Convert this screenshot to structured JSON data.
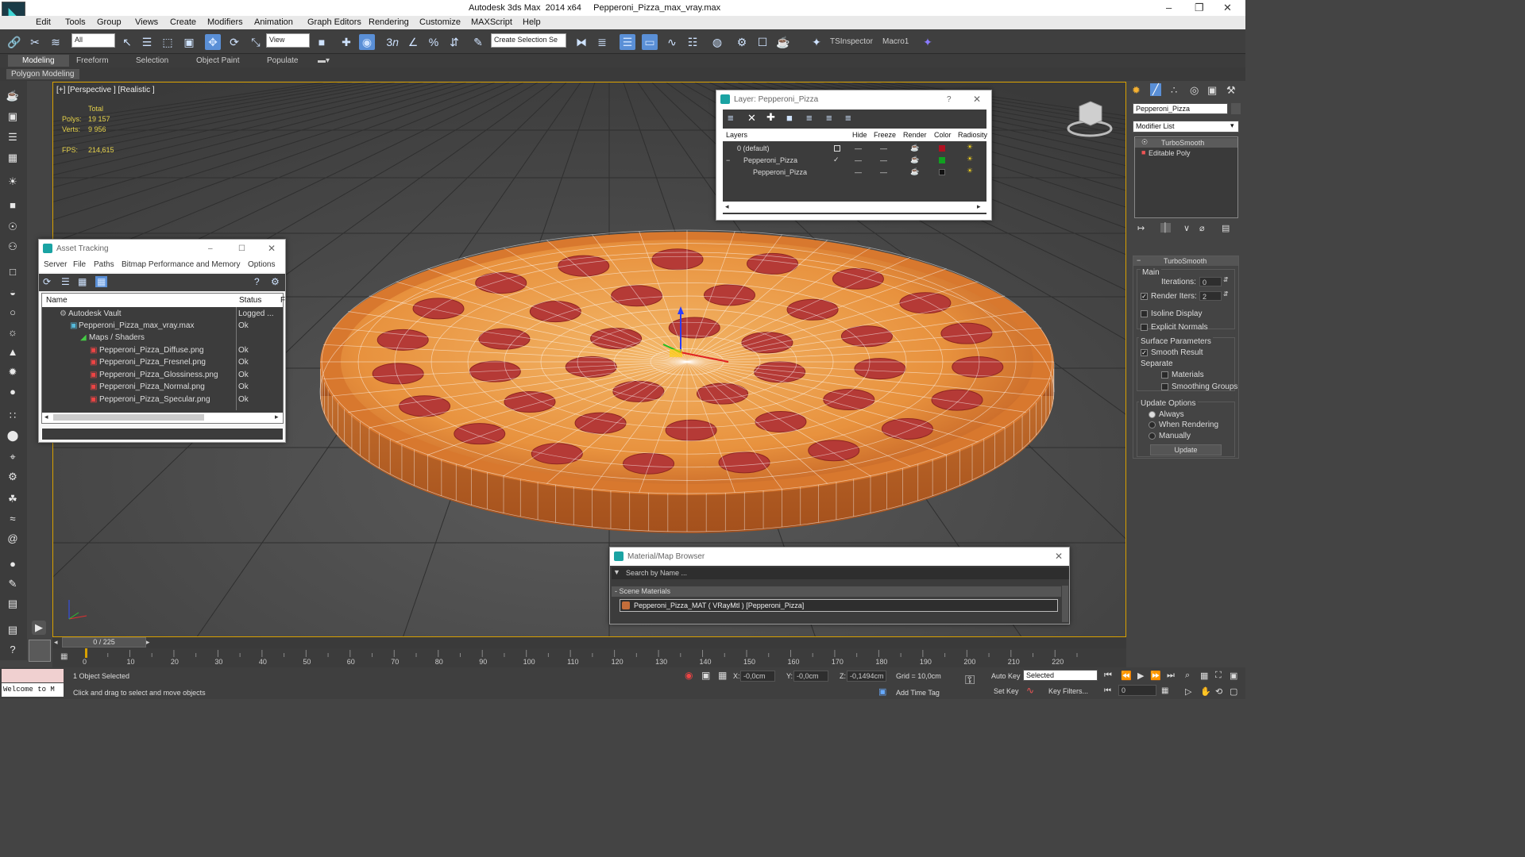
{
  "window": {
    "title": "Autodesk 3ds Max  2014 x64     Pepperoni_Pizza_max_vray.max"
  },
  "menu": [
    "Edit",
    "Tools",
    "Group",
    "Views",
    "Create",
    "Modifiers",
    "Animation",
    "Graph Editors",
    "Rendering",
    "Customize",
    "MAXScript",
    "Help"
  ],
  "toolbar": {
    "filter": "All",
    "ref_coord": "View",
    "selection_set": "Create Selection Se",
    "ts_inspector": "TSInspector",
    "macro": "Macro1"
  },
  "ribbon": {
    "tabs": [
      "Modeling",
      "Freeform",
      "Selection",
      "Object Paint",
      "Populate"
    ],
    "active": "Modeling",
    "sub": "Polygon Modeling"
  },
  "viewport": {
    "label": "[+] [Perspective ] [Realistic ]",
    "stats": {
      "total_label": "Total",
      "polys_label": "Polys:",
      "polys": "19 157",
      "verts_label": "Verts:",
      "verts": "9 956",
      "fps_label": "FPS:",
      "fps": "214,615"
    }
  },
  "layer_dialog": {
    "title": "Layer: Pepperoni_Pizza",
    "columns": [
      "Layers",
      "Hide",
      "Freeze",
      "Render",
      "Color",
      "Radiosity"
    ],
    "rows": [
      {
        "name": "0 (default)",
        "color": "#b01020"
      },
      {
        "name": "Pepperoni_Pizza",
        "color": "#10a020"
      },
      {
        "name": "Pepperoni_Pizza",
        "color": "#111111"
      }
    ]
  },
  "asset_tracking": {
    "title": "Asset Tracking",
    "menu": [
      "Server",
      "File",
      "Paths",
      "Bitmap Performance and Memory",
      "Options"
    ],
    "columns": [
      "Name",
      "Status",
      "F"
    ],
    "rows": [
      {
        "name": "Autodesk Vault",
        "status": "Logged ..."
      },
      {
        "name": "Pepperoni_Pizza_max_vray.max",
        "status": "Ok"
      },
      {
        "name": "Maps / Shaders",
        "status": ""
      },
      {
        "name": "Pepperoni_Pizza_Diffuse.png",
        "status": "Ok"
      },
      {
        "name": "Pepperoni_Pizza_Fresnel.png",
        "status": "Ok"
      },
      {
        "name": "Pepperoni_Pizza_Glossiness.png",
        "status": "Ok"
      },
      {
        "name": "Pepperoni_Pizza_Normal.png",
        "status": "Ok"
      },
      {
        "name": "Pepperoni_Pizza_Specular.png",
        "status": "Ok"
      }
    ]
  },
  "material_browser": {
    "title": "Material/Map Browser",
    "search_placeholder": "Search by Name ...",
    "section": "- Scene Materials",
    "item": "Pepperoni_Pizza_MAT  ( VRayMtl )  [Pepperoni_Pizza]"
  },
  "command_panel": {
    "object_name": "Pepperoni_Pizza",
    "modifier_list": "Modifier List",
    "stack": [
      "TurboSmooth",
      "Editable Poly"
    ],
    "rollout_title": "TurboSmooth",
    "main_label": "Main",
    "iterations_label": "Iterations:",
    "iterations": "0",
    "render_iters_label": "Render Iters:",
    "render_iters": "2",
    "isoline": "Isoline Display",
    "explicit_normals": "Explicit Normals",
    "surface_params": "Surface Parameters",
    "smooth_result": "Smooth Result",
    "separate": "Separate",
    "materials": "Materials",
    "smoothing_groups": "Smoothing Groups",
    "update_options": "Update Options",
    "always": "Always",
    "when_rendering": "When Rendering",
    "manually": "Manually",
    "update_button": "Update"
  },
  "timeline": {
    "frame": "0 / 225",
    "ticks": [
      "0",
      "10",
      "20",
      "30",
      "40",
      "50",
      "60",
      "70",
      "80",
      "90",
      "100",
      "110",
      "120",
      "130",
      "140",
      "150",
      "160",
      "170",
      "180",
      "190",
      "200",
      "210",
      "220"
    ]
  },
  "status": {
    "maxscript": "Welcome to M",
    "selected": "1 Object Selected",
    "prompt": "Click and drag to select and move objects",
    "x_label": "X:",
    "x": "-0,0cm",
    "y_label": "Y:",
    "y": "-0,0cm",
    "z_label": "Z:",
    "z": "-0,1494cm",
    "grid": "Grid = 10,0cm",
    "add_time_tag": "Add Time Tag",
    "auto_key": "Auto Key",
    "set_key": "Set Key",
    "key_mode": "Selected",
    "key_filters": "Key Filters...",
    "current_frame": "0"
  }
}
